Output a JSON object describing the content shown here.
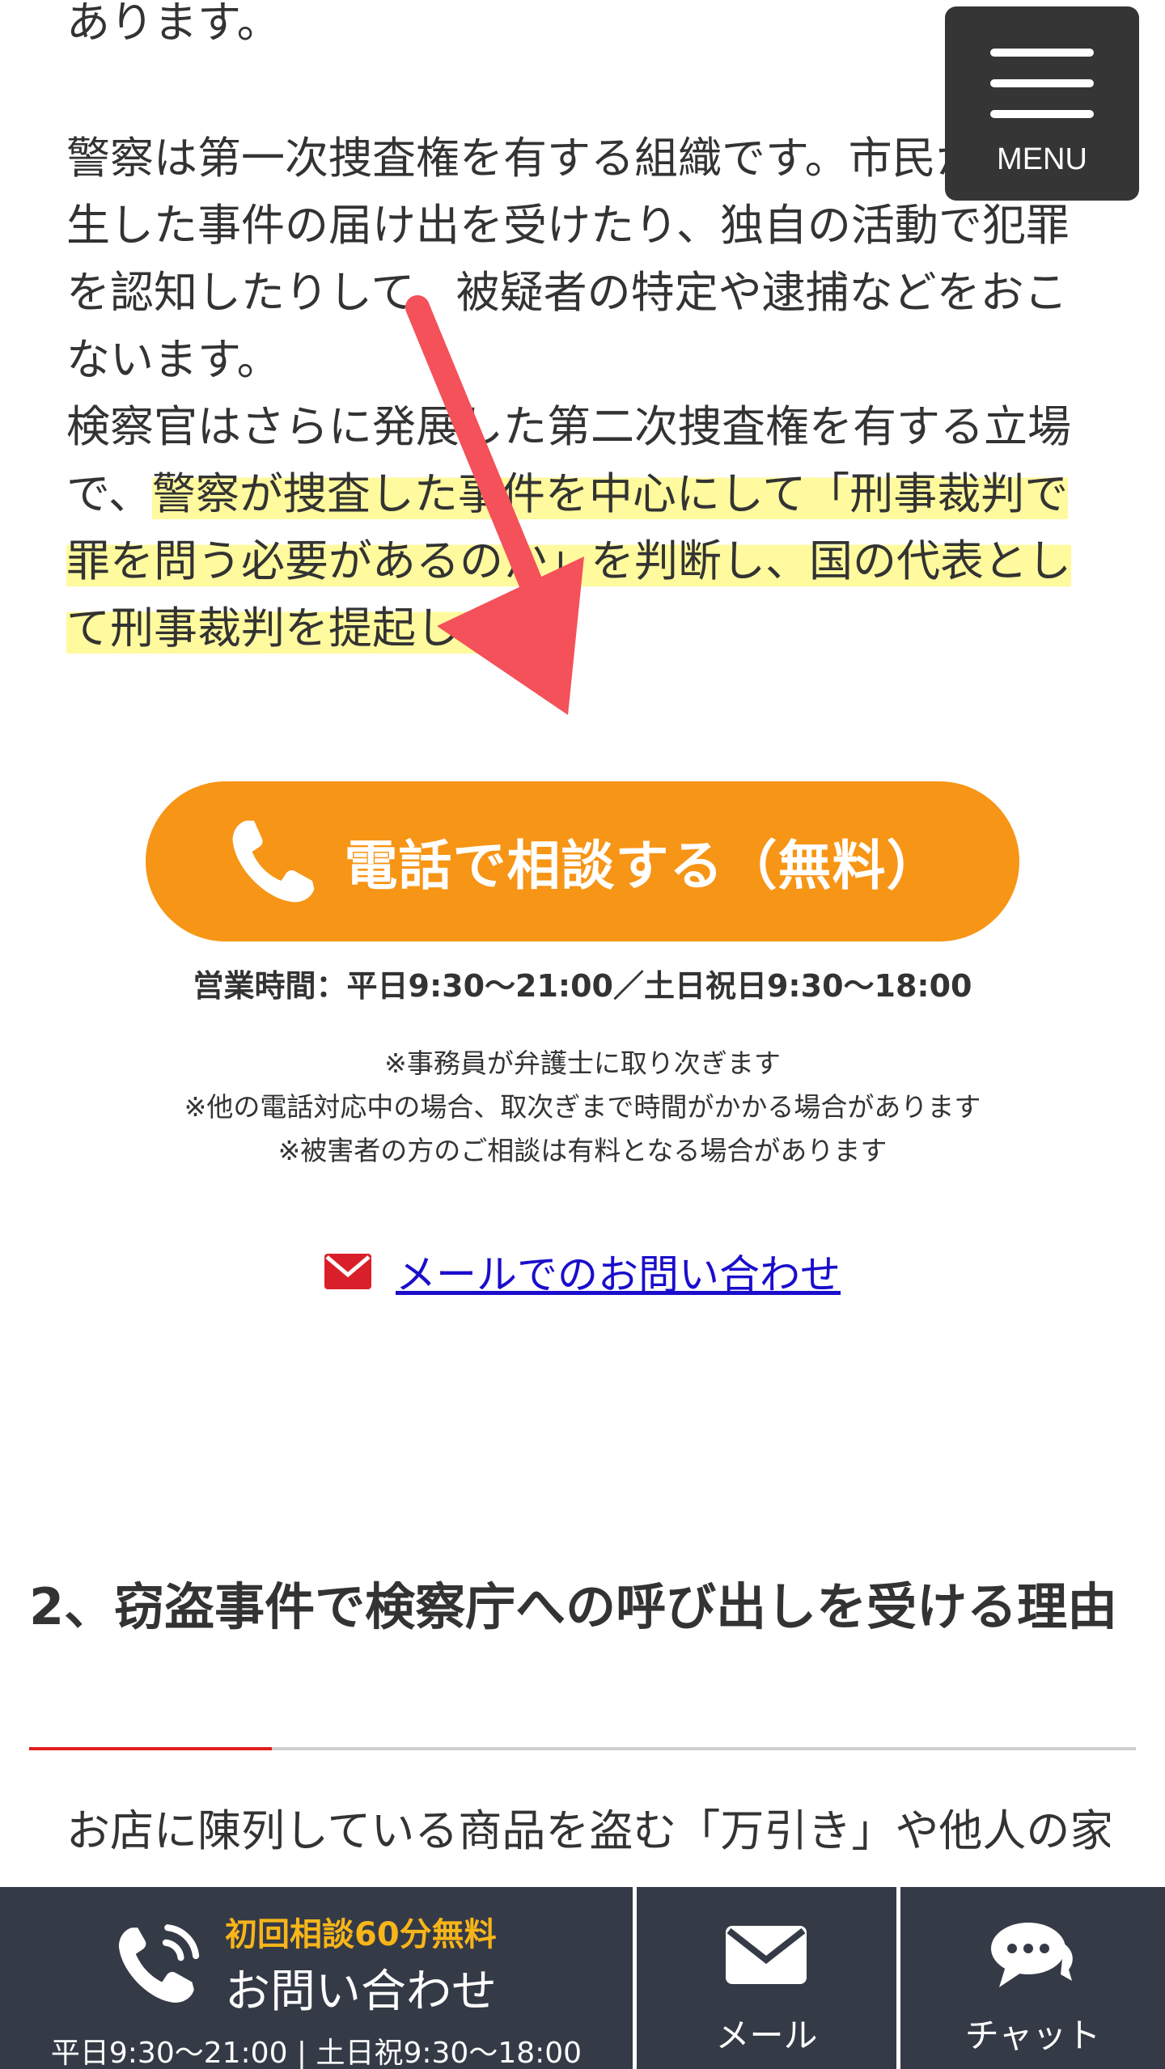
{
  "article": {
    "line_top": "あります。",
    "police": "警察は第一次捜査権を有する組織です。市民から発生した事件の届け出を受けたり、独自の活動で犯罪を認知したりして、被疑者の特定や逮捕などをおこないます。",
    "prosecutor_before": "検察官はさらに発展した第二次捜査権を有する立場で、",
    "prosecutor_highlight": "警察が捜査した事件を中心にして「刑事裁判で罪を問う必要があるのか」を判断し、国の代表として刑事裁判を提起します",
    "prosecutor_after": "。"
  },
  "menu": {
    "label": "MENU"
  },
  "cta": {
    "phone_label": "電話で相談する（無料）",
    "hours": "営業時間：平日9:30〜21:00／土日祝日9:30〜18:00",
    "notes": [
      "※事務員が弁護士に取り次ぎます",
      "※他の電話対応中の場合、取次ぎまで時間がかかる場合があります",
      "※被害者の方のご相談は有料となる場合があります"
    ],
    "mail_link": "メールでのお問い合わせ"
  },
  "section2": {
    "heading": "2、窃盗事件で検察庁への呼び出しを受ける理由",
    "body": "お店に陳列している商品を盗む「万引き」や他人の家に立ち入って金品などを盗む「空き巣」"
  },
  "bottom_bar": {
    "free_label": "初回相談60分無料",
    "contact_label": "お問い合わせ",
    "hours": "平日9:30〜21:00 | 土日祝9:30〜18:00",
    "mail_label": "メール",
    "chat_label": "チャット"
  },
  "colors": {
    "accent_orange": "#f79516",
    "highlight_yellow": "#fffa9e",
    "arrow_red": "#f4515a",
    "bottom_bar_bg": "#353a47",
    "link_blue": "#1a0dcc",
    "heading_rule_red": "#e0201d"
  }
}
